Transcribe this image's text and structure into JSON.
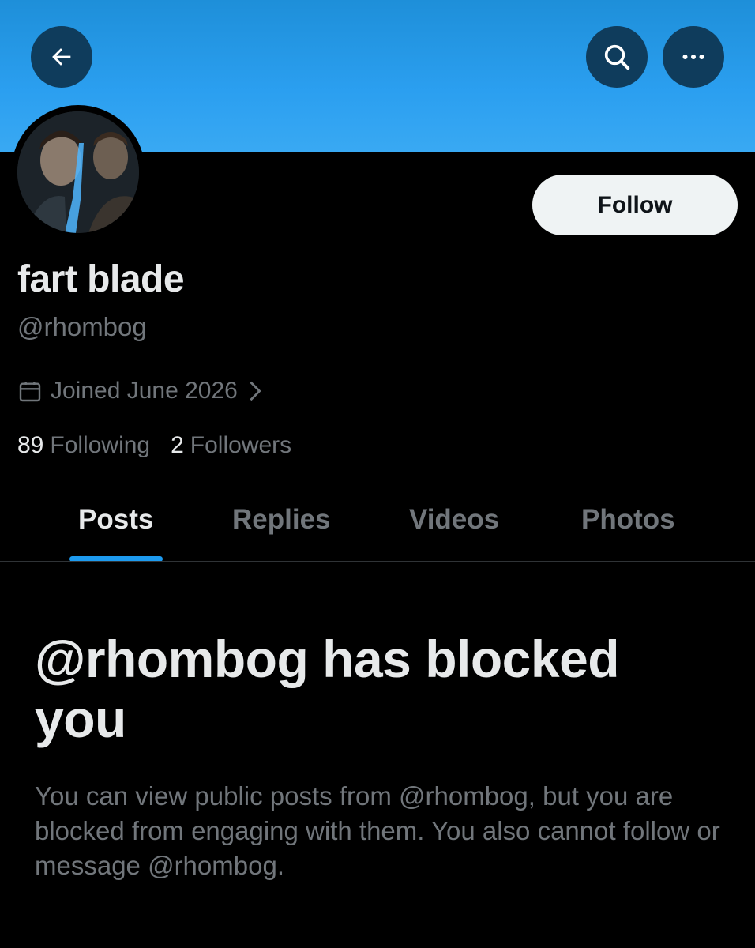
{
  "header": {
    "back_icon": "arrow-left-icon",
    "search_icon": "search-icon",
    "more_icon": "more-horizontal-icon",
    "banner_color": "#2b9ff0"
  },
  "profile": {
    "display_name": "fart blade",
    "handle": "@rhombog",
    "joined": "Joined June 2026",
    "following_count": "89",
    "following_label": "Following",
    "followers_count": "2",
    "followers_label": "Followers"
  },
  "actions": {
    "follow_label": "Follow"
  },
  "tabs": [
    {
      "label": "Posts",
      "active": true
    },
    {
      "label": "Replies",
      "active": false
    },
    {
      "label": "Videos",
      "active": false
    },
    {
      "label": "Photos",
      "active": false
    }
  ],
  "blocked": {
    "title": "@rhombog has blocked you",
    "message": "You can view public posts from @rhombog, but you are blocked from engaging with them. You also cannot follow or message @rhombog."
  },
  "colors": {
    "accent": "#1d9bf0",
    "muted_text": "#71767b",
    "primary_text": "#e7e9ea"
  }
}
